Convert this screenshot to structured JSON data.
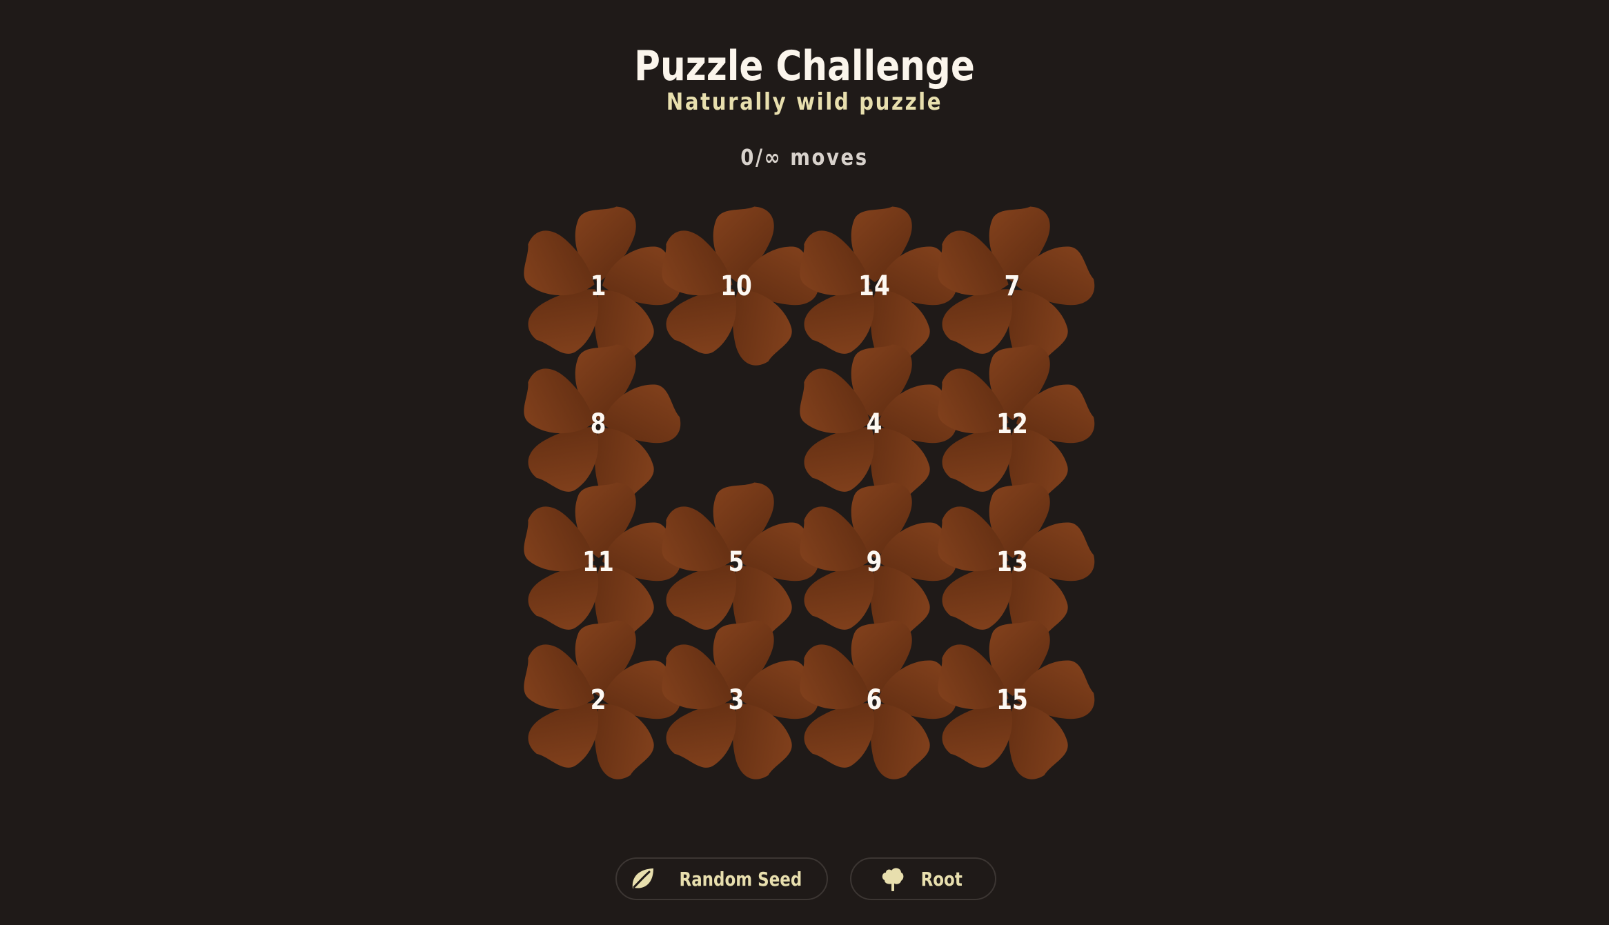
{
  "header": {
    "title": "Puzzle Challenge",
    "subtitle": "Naturally wild puzzle",
    "moves": "0/∞ moves"
  },
  "board": {
    "rows": 4,
    "cols": 4,
    "tiles": [
      [
        "1",
        "10",
        "14",
        "7"
      ],
      [
        "8",
        "",
        "4",
        "12"
      ],
      [
        "11",
        "5",
        "9",
        "13"
      ],
      [
        "2",
        "3",
        "6",
        "15"
      ]
    ]
  },
  "colors": {
    "background": "#1f1a18",
    "petal_light": "#84421d",
    "petal_dark": "#5f2c11",
    "accent_text": "#e8dfae"
  },
  "buttons": {
    "random_seed": {
      "label": "Random Seed",
      "icon": "leaf-icon"
    },
    "root": {
      "label": "Root",
      "icon": "tree-icon"
    }
  }
}
